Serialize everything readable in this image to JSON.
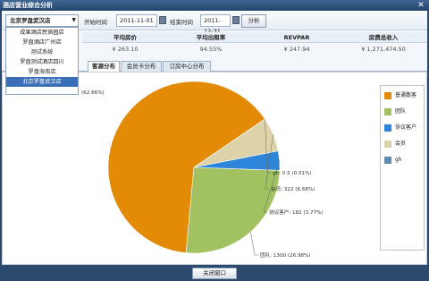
{
  "window": {
    "title": "酒店营业综合分析"
  },
  "toolbar": {
    "hotel_selected": "北京罗盘武汉店",
    "start_label": "开始时间",
    "start_date": "2011-11-01",
    "end_label": "结束时间",
    "end_date": "2011-12-31",
    "analyze_label": "分析"
  },
  "dropdown": {
    "options": [
      "成果酒店民宿园店",
      "罗盘酒店广州店",
      "测试系统",
      "罗盘测试酒店四川",
      "罗盘海南店",
      "北京罗盘武汉店"
    ]
  },
  "stats": {
    "headers": [
      "平均房价",
      "平均出租率",
      "REVPAR",
      "房费总收入"
    ],
    "values": [
      "¥ 263.10",
      "94.55%",
      "¥ 247.94",
      "¥ 1,271,474.50"
    ]
  },
  "tabs": [
    "客源分布",
    "会员卡分布",
    "订房中心分布"
  ],
  "chart_data": {
    "type": "pie",
    "title": "",
    "legend_position": "right",
    "series": [
      {
        "name": "普通散客",
        "value": 3212,
        "percent": 62.66,
        "label": "(62.66%)",
        "color": "#e38a06"
      },
      {
        "name": "团队",
        "value": 1300,
        "percent": 26.98,
        "label": "团队: 1300 (26.98%)",
        "color": "#a2c160"
      },
      {
        "name": "协议客户",
        "value": 182,
        "percent": 3.77,
        "label": "协议客户: 182 (3.77%)",
        "color": "#2d86d9"
      },
      {
        "name": "会员",
        "value": 322,
        "percent": 6.68,
        "label": "会员: 322 (6.68%)",
        "color": "#ded2a8"
      },
      {
        "name": "gh",
        "value": 0.5,
        "percent": 0.01,
        "label": "gh: 0.5 (0.01%)",
        "color": "#5f8db2"
      }
    ]
  },
  "footer": {
    "close_label": "关闭窗口"
  }
}
